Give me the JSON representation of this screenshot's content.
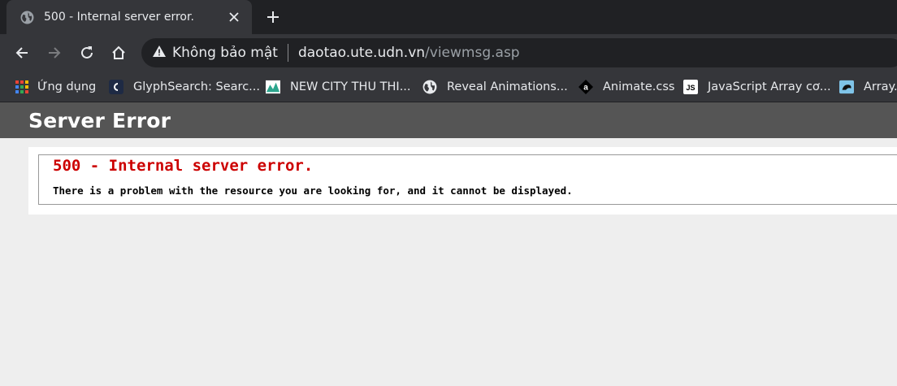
{
  "browser": {
    "tab": {
      "title": "500 - Internal server error."
    },
    "toolbar": {
      "security_label": "Không bảo mật",
      "url_host": "daotao.ute.udn.vn",
      "url_path": "/viewmsg.asp"
    },
    "bookmarks": [
      {
        "label": "Ứng dụng",
        "icon": "apps-grid-icon"
      },
      {
        "label": "GlyphSearch: Searc...",
        "icon": "glyphsearch-icon"
      },
      {
        "label": "NEW CITY THU THI...",
        "icon": "newcity-icon"
      },
      {
        "label": "Reveal Animations...",
        "icon": "globe-icon"
      },
      {
        "label": "Animate.css",
        "icon": "animate-css-icon"
      },
      {
        "label": "JavaScript Array cơ...",
        "icon": "js-icon"
      },
      {
        "label": "Array.p",
        "icon": "array-icon"
      }
    ]
  },
  "page": {
    "header": "Server Error",
    "error_title": "500 - Internal server error.",
    "error_message": "There is a problem with the resource you are looking for, and it cannot be displayed."
  },
  "colors": {
    "header_bg": "#555555",
    "error_red": "#cc0000",
    "page_bg": "#eeeeee"
  }
}
